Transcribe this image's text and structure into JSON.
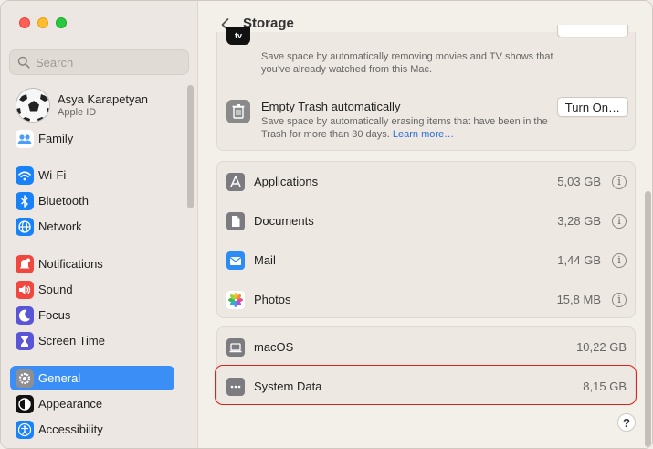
{
  "sidebar": {
    "search_placeholder": "Search",
    "account": {
      "name": "Asya Karapetyan",
      "subtitle": "Apple ID"
    },
    "items": [
      {
        "label": "Family",
        "icon": "family-icon",
        "color": "#ffffff"
      },
      {
        "label": "Wi-Fi",
        "icon": "wifi-icon",
        "color": "#1a82f7"
      },
      {
        "label": "Bluetooth",
        "icon": "bluetooth-icon",
        "color": "#1a82f7"
      },
      {
        "label": "Network",
        "icon": "globe-icon",
        "color": "#1a82f7"
      },
      {
        "label": "Notifications",
        "icon": "bell-icon",
        "color": "#f0473e"
      },
      {
        "label": "Sound",
        "icon": "speaker-icon",
        "color": "#f0473e"
      },
      {
        "label": "Focus",
        "icon": "moon-icon",
        "color": "#5a54d6"
      },
      {
        "label": "Screen Time",
        "icon": "hourglass-icon",
        "color": "#5a54d6"
      },
      {
        "label": "General",
        "icon": "gear-icon",
        "color": "#8e8e93",
        "selected": true
      },
      {
        "label": "Appearance",
        "icon": "appearance-icon",
        "color": "#111111"
      },
      {
        "label": "Accessibility",
        "icon": "accessibility-icon",
        "color": "#1a82f7"
      }
    ]
  },
  "header": {
    "title": "Storage"
  },
  "recommendations": [
    {
      "title": "",
      "description": "Save space by automatically removing movies and TV shows that you’ve already watched from this Mac.",
      "icon": "apple-tv-icon"
    },
    {
      "title": "Empty Trash automatically",
      "description": "Save space by automatically erasing items that have been in the Trash for more than 30 days.",
      "link": "Learn more…",
      "button": "Turn On…",
      "icon": "trash-icon"
    }
  ],
  "categories": [
    {
      "label": "Applications",
      "size": "5,03 GB",
      "icon": "applications-icon"
    },
    {
      "label": "Documents",
      "size": "3,28 GB",
      "icon": "document-icon"
    },
    {
      "label": "Mail",
      "size": "1,44 GB",
      "icon": "mail-icon"
    },
    {
      "label": "Photos",
      "size": "15,8 MB",
      "icon": "photos-icon"
    }
  ],
  "system": [
    {
      "label": "macOS",
      "size": "10,22 GB",
      "icon": "laptop-icon"
    },
    {
      "label": "System Data",
      "size": "8,15 GB",
      "icon": "ellipsis-icon"
    }
  ],
  "help_label": "?",
  "colors": {
    "accent": "#3b8ef5",
    "highlight": "#d9231c"
  }
}
